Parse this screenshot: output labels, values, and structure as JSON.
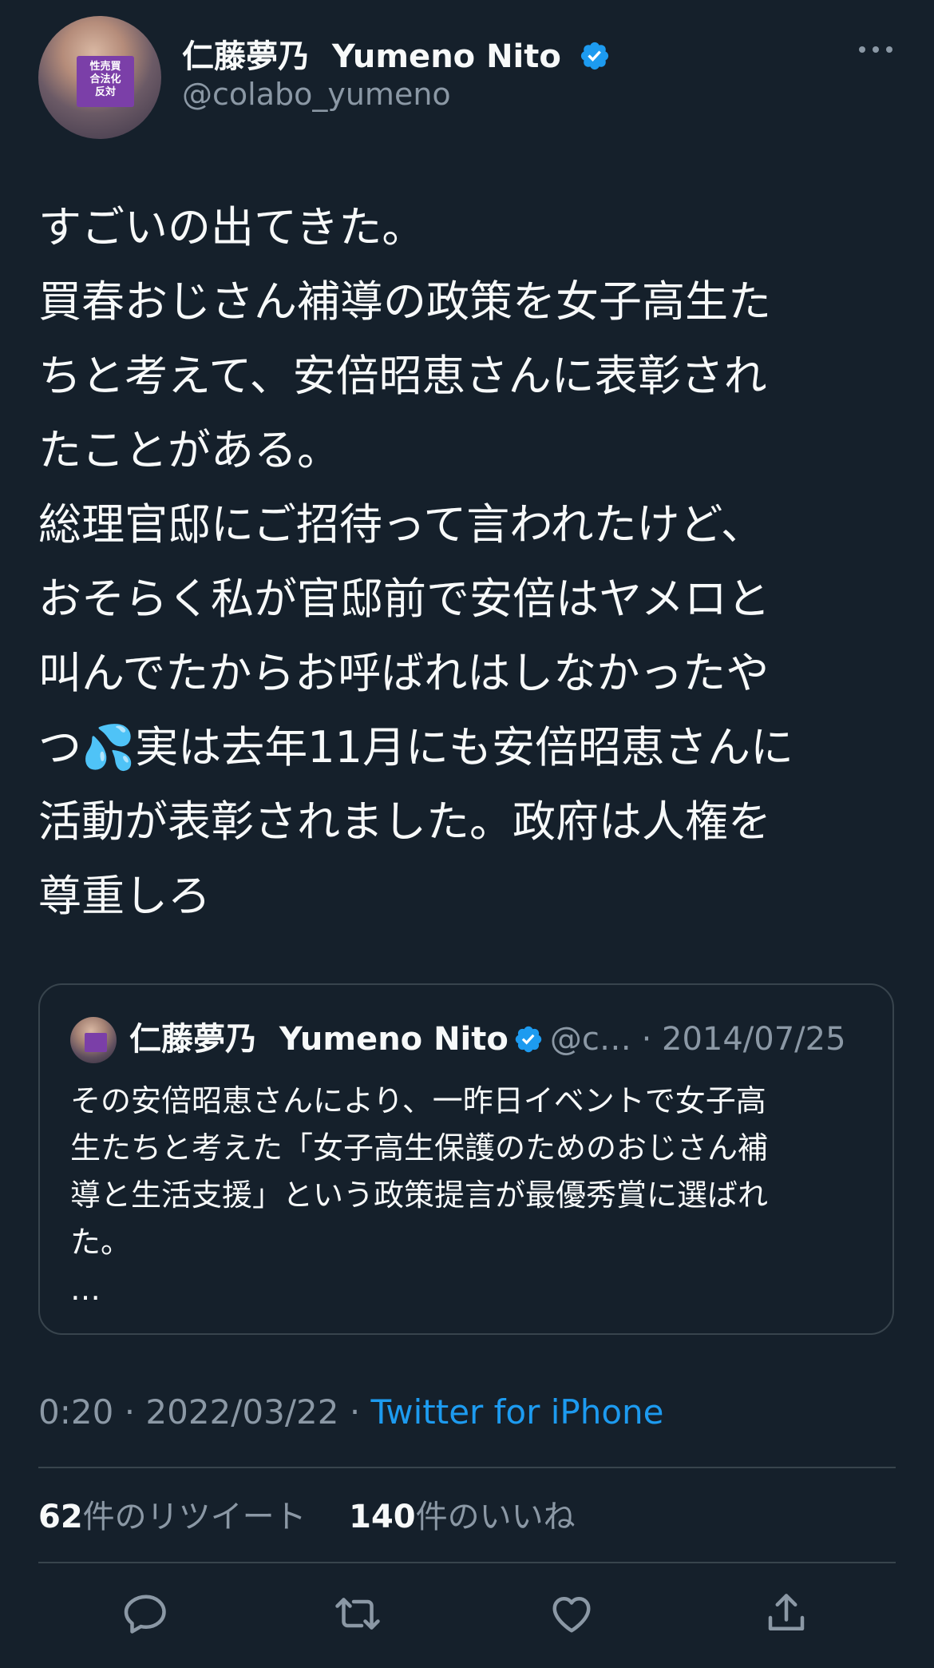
{
  "tweet": {
    "display_name": "仁藤夢乃  Yumeno Nito",
    "handle": "@colabo_yumeno",
    "avatar_sign_text": "性売買\n合法化\n反対",
    "lines": [
      "すごいの出てきた。",
      "買春おじさん補導の政策を女子高生た",
      "ちと考えて、安倍昭恵さんに表彰され",
      "たことがある。",
      "総理官邸にご招待って言われたけど、",
      "おそらく私が官邸前で安倍はヤメロと",
      "叫んでたからお呼ばれはしなかったや",
      "つ💦実は去年11月にも安倍昭恵さんに",
      "活動が表彰されました。政府は人権を",
      "尊重しろ"
    ],
    "time": "0:20",
    "date": "2022/03/22",
    "source": "Twitter for iPhone",
    "retweet_count": "62",
    "retweet_label": "件のリツイート",
    "like_count": "140",
    "like_label": "件のいいね"
  },
  "quote": {
    "display_name": "仁藤夢乃  Yumeno Nito",
    "meta": "@c… · 2014/07/25",
    "lines": [
      "その安倍昭恵さんにより、一昨日イベントで女子高",
      "生たちと考えた「女子高生保護のためのおじさん補",
      "導と生活支援」という政策提言が最優秀賞に選ばれ",
      "た。",
      "…"
    ]
  },
  "icons": {
    "verified": "verified-badge-icon",
    "more": "more-dots-icon",
    "reply": "reply-icon",
    "retweet": "retweet-icon",
    "like": "heart-icon",
    "share": "share-icon"
  },
  "colors": {
    "background": "#15202b",
    "text": "#f7f9f9",
    "secondary": "#8b98a5",
    "accent": "#1d9bf0",
    "border": "#38444d"
  }
}
